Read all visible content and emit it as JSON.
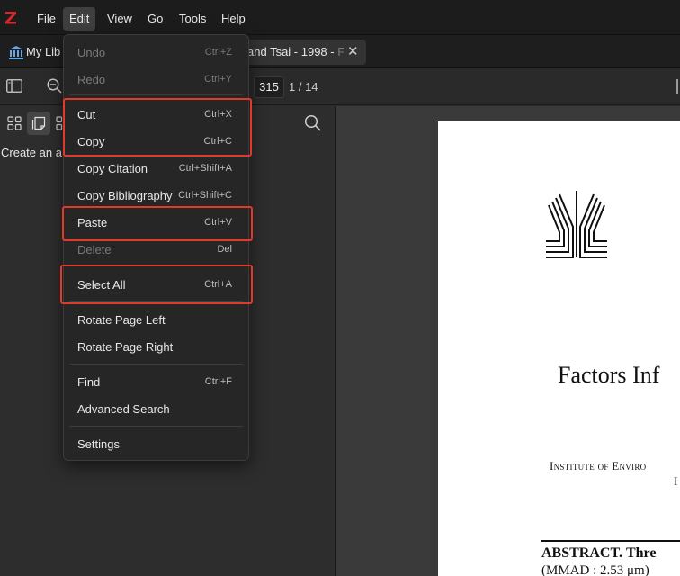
{
  "menubar": {
    "items": [
      "File",
      "Edit",
      "View",
      "Go",
      "Tools",
      "Help"
    ],
    "active": "Edit"
  },
  "tabs": {
    "library_label": "My Lib",
    "document_title": "and Tsai - 1998 - ",
    "document_title_fade": "F"
  },
  "toolbar": {
    "page_input": "315",
    "page_count": "1 / 14"
  },
  "sidebar": {
    "hint": "Create an a"
  },
  "edit_menu": [
    {
      "label": "Undo",
      "shortcut": "Ctrl+Z",
      "enabled": false
    },
    {
      "label": "Redo",
      "shortcut": "Ctrl+Y",
      "enabled": false
    },
    {
      "label": "Cut",
      "shortcut": "Ctrl+X",
      "enabled": true
    },
    {
      "label": "Copy",
      "shortcut": "Ctrl+C",
      "enabled": true
    },
    {
      "label": "Copy Citation",
      "shortcut": "Ctrl+Shift+A",
      "enabled": true
    },
    {
      "label": "Copy Bibliography",
      "shortcut": "Ctrl+Shift+C",
      "enabled": true
    },
    {
      "label": "Paste",
      "shortcut": "Ctrl+V",
      "enabled": true
    },
    {
      "label": "Delete",
      "shortcut": "Del",
      "enabled": false
    },
    {
      "label": "Select All",
      "shortcut": "Ctrl+A",
      "enabled": true
    },
    {
      "label": "Rotate Page Left",
      "shortcut": "",
      "enabled": true
    },
    {
      "label": "Rotate Page Right",
      "shortcut": "",
      "enabled": true
    },
    {
      "label": "Find",
      "shortcut": "Ctrl+F",
      "enabled": true
    },
    {
      "label": "Advanced Search",
      "shortcut": "",
      "enabled": true
    },
    {
      "label": "Settings",
      "shortcut": "",
      "enabled": true
    }
  ],
  "document_page": {
    "title": "Factors Inf",
    "institute_line": "Institute of Enviro",
    "institute_line2": "I",
    "abstract_label": "ABSTRACT.",
    "abstract_text": "Thre",
    "abstract_line2": "(MMAD : 2.53 μm)"
  },
  "colors": {
    "accent": "#e03a2a",
    "logo_red": "#d9262c",
    "menu_bg": "#262626",
    "app_bg": "#2b2b2b"
  },
  "icons": [
    "zotero-logo-icon",
    "library-icon",
    "sidebar-toggle-icon",
    "zoom-out-icon",
    "thumbnails-icon",
    "outline-icon",
    "search-icon",
    "close-icon"
  ]
}
